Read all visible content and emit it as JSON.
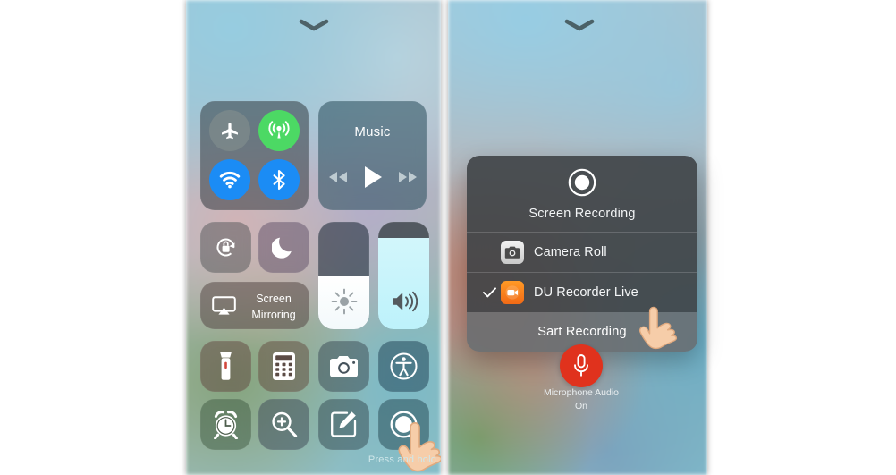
{
  "screen": {
    "left_panel_name": "iOS Control Center",
    "right_panel_name": "Screen Recording options"
  },
  "left_panel": {
    "handle_icon": "chevron-down-icon",
    "connectivity": {
      "airplane_icon": "airplane-mode-icon",
      "cellular_icon": "cellular-data-icon",
      "wifi_icon": "wifi-icon",
      "bluetooth_icon": "bluetooth-icon",
      "airplane_color": "#808c8c",
      "cellular_color": "#4cd964",
      "wifi_color": "#1b8cf5",
      "bluetooth_color": "#1b8cf5"
    },
    "music": {
      "title": "Music",
      "rewind_icon": "rewind-icon",
      "play_icon": "play-icon",
      "forward_icon": "fast-forward-icon"
    },
    "rotation_lock": {
      "icon": "rotation-lock-icon"
    },
    "do_not_disturb": {
      "icon": "moon-icon"
    },
    "screen_mirroring": {
      "label_line1": "Screen",
      "label_line2": "Mirroring",
      "icon": "airplay-screen-icon"
    },
    "brightness": {
      "icon": "brightness-sun-icon",
      "level_percent": 50
    },
    "volume": {
      "icon": "volume-speaker-icon",
      "level_percent": 85
    },
    "shortcuts": [
      {
        "name": "flashlight",
        "icon": "flashlight-icon"
      },
      {
        "name": "calculator",
        "icon": "calculator-icon"
      },
      {
        "name": "camera",
        "icon": "camera-icon"
      },
      {
        "name": "accessibility",
        "icon": "accessibility-icon"
      },
      {
        "name": "alarm",
        "icon": "alarm-clock-icon"
      },
      {
        "name": "magnifier",
        "icon": "magnifier-zoom-icon"
      },
      {
        "name": "notes",
        "icon": "notes-compose-icon"
      },
      {
        "name": "screen-record",
        "icon": "screen-record-icon"
      }
    ],
    "hint_text": "Press and hold",
    "cursor_icon": "pointing-hand-cursor"
  },
  "right_panel": {
    "handle_icon": "chevron-down-icon",
    "sheet": {
      "record_icon": "record-target-icon",
      "title": "Screen Recording",
      "options": [
        {
          "label": "Camera Roll",
          "icon": "camera-app-icon",
          "checked": false
        },
        {
          "label": "DU Recorder Live",
          "icon": "du-recorder-icon",
          "checked": true
        }
      ],
      "check_icon": "checkmark-icon",
      "action_label": "Sart Recording",
      "cursor_icon": "pointing-hand-cursor"
    },
    "microphone": {
      "icon": "microphone-icon",
      "color": "#e0321d",
      "caption_line1": "Microphone Audio",
      "caption_line2": "On"
    }
  }
}
